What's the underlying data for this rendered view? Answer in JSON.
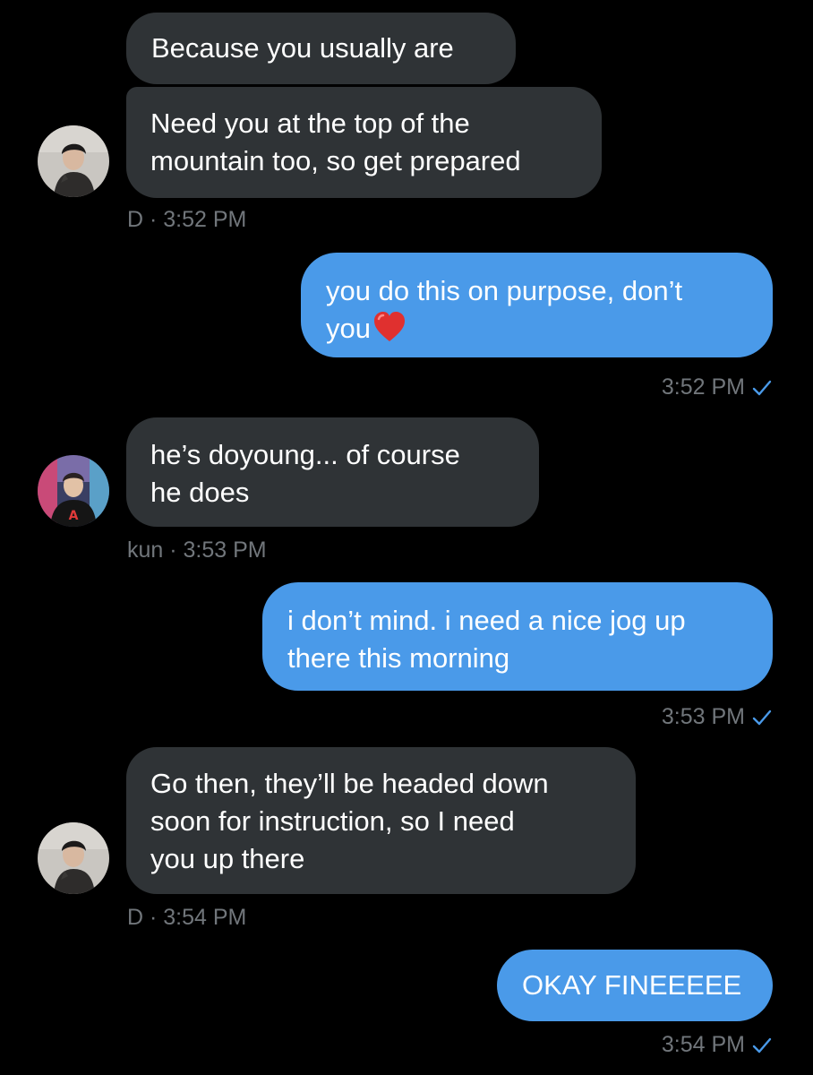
{
  "messages": [
    {
      "id": "m1",
      "direction": "incoming",
      "text": "Because you usually are"
    },
    {
      "id": "m2",
      "direction": "incoming",
      "text": "Need you at the top of the mountain too, so get prepared",
      "lines": [
        "Need you at the top of the",
        "mountain too, so get prepared"
      ],
      "sender": "D",
      "time": "3:52 PM",
      "avatar_icon": "avatar-d"
    },
    {
      "id": "m3",
      "direction": "outgoing",
      "text": "you do this on purpose, don’t you",
      "lines": [
        "you do this on purpose, don’t",
        "you"
      ],
      "emoji": "red-heart-icon",
      "time": "3:52 PM",
      "status_icon": "checkmark-icon"
    },
    {
      "id": "m4",
      "direction": "incoming",
      "text": "he’s doyoung... of course he does",
      "lines": [
        "he’s doyoung... of course",
        "he does"
      ],
      "sender": "kun",
      "time": "3:53 PM",
      "avatar_icon": "avatar-kun"
    },
    {
      "id": "m5",
      "direction": "outgoing",
      "text": "i don’t mind. i need a nice jog up there this morning",
      "lines": [
        "i don’t mind. i need a nice jog up",
        "there this morning"
      ],
      "time": "3:53 PM",
      "status_icon": "checkmark-icon"
    },
    {
      "id": "m6",
      "direction": "incoming",
      "text": "Go then, they’ll be headed down soon for instruction, so I need you up there",
      "lines": [
        "Go then, they’ll be headed down",
        "soon for instruction, so I need",
        "you up there"
      ],
      "sender": "D",
      "time": "3:54 PM",
      "avatar_icon": "avatar-d"
    },
    {
      "id": "m7",
      "direction": "outgoing",
      "text": "OKAY FINEEEEE",
      "time": "3:54 PM",
      "status_icon": "checkmark-icon"
    }
  ],
  "meta": {
    "m2": "D · 3:52 PM",
    "m3": "3:52 PM",
    "m4": "kun · 3:53 PM",
    "m5": "3:53 PM",
    "m6": "D · 3:54 PM",
    "m7": "3:54 PM"
  },
  "colors": {
    "background": "#000000",
    "incoming_bubble": "#2f3336",
    "outgoing_bubble": "#4a9ae9",
    "meta_text": "#71767b",
    "checkmark": "#4a9ae9"
  }
}
